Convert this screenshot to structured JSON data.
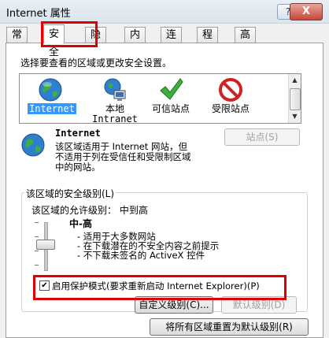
{
  "window": {
    "title": "Internet 属性",
    "help_button": "?",
    "close_button": "X"
  },
  "tabs": [
    "常规",
    "安全",
    "隐私",
    "内容",
    "连接",
    "程序",
    "高级"
  ],
  "security": {
    "zone_prompt": "选择要查看的区域或更改安全设置。",
    "zones": [
      {
        "label": "Internet",
        "icon": "globe-icon"
      },
      {
        "label": "本地\nIntranet",
        "icon": "local-intranet-icon"
      },
      {
        "label": "可信站点",
        "icon": "checkmark-icon"
      },
      {
        "label": "受限站点",
        "icon": "no-entry-icon"
      }
    ],
    "selected_zone_title": "Internet",
    "zone_description": "该区域适用于 Internet 网站，但\n不适用于列在受信任和受限制区域\n中的网站。",
    "sites_button": "站点(S)",
    "level_group_label": "该区域的安全级别(L)",
    "allowed_levels_text": "该区域的允许级别： 中到高",
    "level_name": "中-高",
    "level_bullets": [
      "- 适用于大多数网站",
      "- 在下载潜在的不安全内容之前提示",
      "- 不下载未签名的 ActiveX 控件"
    ],
    "protected_mode_label": "启用保护模式(要求重新启动 Internet Explorer)(P)",
    "protected_mode_checked": true,
    "custom_level_button": "自定义级别(C)...",
    "default_level_button": "默认级别(D)",
    "reset_all_button": "将所有区域重置为默认级别(R)"
  },
  "colors": {
    "highlight": "#e00000",
    "selection": "#3399ff"
  }
}
